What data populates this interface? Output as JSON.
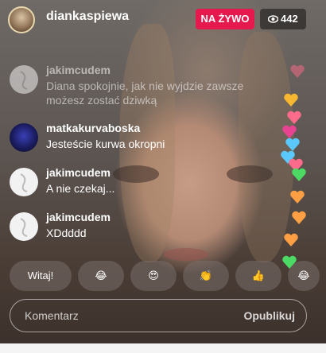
{
  "header": {
    "username": "diankaspiewa",
    "live_label": "NA ŻYWO",
    "viewer_count": "442"
  },
  "comments": [
    {
      "username": "jakimcudem",
      "text": "Diana spokojnie, jak nie wyjdzie zawsze możesz zostać dziwką"
    },
    {
      "username": "matkakurvaboska",
      "text": "Jesteście kurwa okropni"
    },
    {
      "username": "jakimcudem",
      "text": "A nie czekaj..."
    },
    {
      "username": "jakimcudem",
      "text": "XDdddd"
    }
  ],
  "reactions": {
    "witaj_label": "Witaj!",
    "emoji_1": "😂",
    "emoji_2": "😍",
    "emoji_3": "👏",
    "emoji_4": "👍",
    "emoji_5": "😂"
  },
  "composer": {
    "placeholder": "Komentarz",
    "publish_label": "Opublikuj"
  },
  "colors": {
    "live_badge": "#e5194d",
    "hearts": [
      "#ff6b8a",
      "#ff9f43",
      "#f7b731",
      "#4cd964",
      "#5ac8fa",
      "#e84393"
    ]
  }
}
